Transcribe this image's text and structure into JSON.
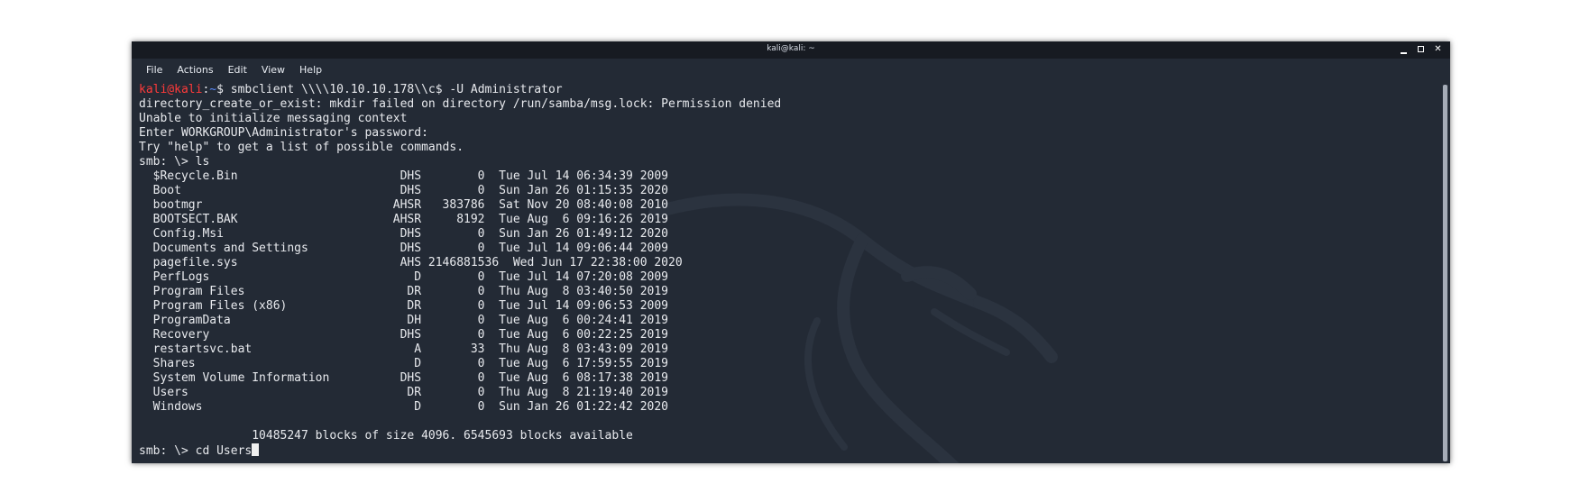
{
  "window": {
    "title": "kali@kali: ~",
    "controls": {
      "minimize": "minimize-icon",
      "maximize": "maximize-icon",
      "close": "close-icon"
    }
  },
  "menu": {
    "file": "File",
    "actions": "Actions",
    "edit": "Edit",
    "view": "View",
    "help": "Help"
  },
  "colors": {
    "background": "#232a35",
    "prompt_user": "#ff3a3a",
    "prompt_path": "#5b8cff",
    "text": "#e8eaee"
  },
  "terminal": {
    "prompt": {
      "user": "kali@kali",
      "sep": ":",
      "path": "~",
      "symbol": "$ ",
      "command": "smbclient \\\\\\\\10.10.10.178\\\\c$ -U Administrator"
    },
    "output": [
      "directory_create_or_exist: mkdir failed on directory /run/samba/msg.lock: Permission denied",
      "Unable to initialize messaging context",
      "Enter WORKGROUP\\Administrator's password:",
      "Try \"help\" to get a list of possible commands.",
      "smb: \\> ls"
    ],
    "listing": [
      "  $Recycle.Bin                       DHS        0  Tue Jul 14 06:34:39 2009",
      "  Boot                               DHS        0  Sun Jan 26 01:15:35 2020",
      "  bootmgr                           AHSR   383786  Sat Nov 20 08:40:08 2010",
      "  BOOTSECT.BAK                      AHSR     8192  Tue Aug  6 09:16:26 2019",
      "  Config.Msi                         DHS        0  Sun Jan 26 01:49:12 2020",
      "  Documents and Settings             DHS        0  Tue Jul 14 09:06:44 2009",
      "  pagefile.sys                       AHS 2146881536  Wed Jun 17 22:38:00 2020",
      "  PerfLogs                             D        0  Tue Jul 14 07:20:08 2009",
      "  Program Files                       DR        0  Thu Aug  8 03:40:50 2019",
      "  Program Files (x86)                 DR        0  Tue Jul 14 09:06:53 2009",
      "  ProgramData                         DH        0  Tue Aug  6 00:24:41 2019",
      "  Recovery                           DHS        0  Tue Aug  6 00:22:25 2019",
      "  restartsvc.bat                       A       33  Thu Aug  8 03:43:09 2019",
      "  Shares                               D        0  Tue Aug  6 17:59:55 2019",
      "  System Volume Information          DHS        0  Tue Aug  6 08:17:38 2019",
      "  Users                               DR        0  Thu Aug  8 21:19:40 2019",
      "  Windows                              D        0  Sun Jan 26 01:22:42 2020"
    ],
    "blank": "",
    "summary": "                10485247 blocks of size 4096. 6545693 blocks available",
    "last_line": "smb: \\> cd Users"
  }
}
